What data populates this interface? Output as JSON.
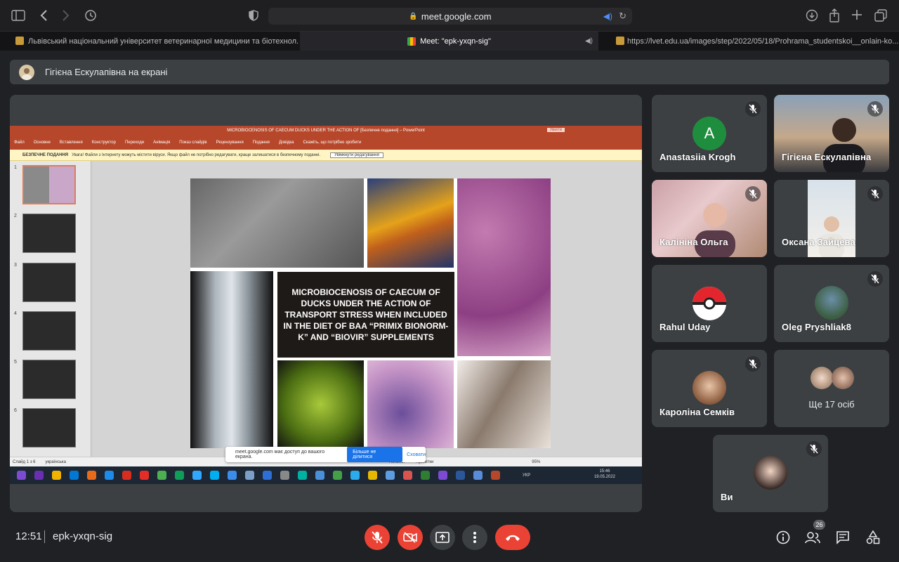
{
  "browser": {
    "url": "meet.google.com",
    "tabs": [
      {
        "label": "Львівський національний університет ветеринарної медицини та біотехнол..."
      },
      {
        "label": "Meet: \"epk-yxqn-sig\""
      },
      {
        "label": "https://lvet.edu.ua/images/step/2022/05/18/Prohrama_studentskoi__onlain-ko..."
      }
    ]
  },
  "banner": {
    "text": "Гігієна Ескулапівна на екрані"
  },
  "powerpoint": {
    "title": "MICROBIOCENOSIS OF CAECUM DUCKS UNDER THE ACTION OF [Безпечне подання] – PowerPoint",
    "login": "Увійти",
    "menu": [
      "Файл",
      "Основне",
      "Вставлення",
      "Конструктор",
      "Переходи",
      "Анімація",
      "Показ слайдів",
      "Рецензування",
      "Подання",
      "Довідка",
      "Скажіть, що потрібно зробити"
    ],
    "warning_label": "БЕЗПЕЧНЕ ПОДАННЯ",
    "warning_text": "Увага! Файли з Інтернету можуть містити віруси. Якщо файл не потрібно редагувати, краще залишатися в безпечному поданні.",
    "warning_button": "Увімкнути редагування",
    "thumb_numbers": [
      "1",
      "2",
      "3",
      "4",
      "5",
      "6"
    ],
    "slide_title": "MICROBIOCENOSIS OF CAECUM OF DUCKS UNDER THE ACTION OF TRANSPORT STRESS WHEN INCLUDED IN THE DIET OF BAA “PRIMIX BIONORM-K” AND “BIOVIR” SUPPLEMENTS",
    "status_left": "Слайд 1 з 6",
    "status_lang": "українська",
    "status_notes": "Нотатки",
    "status_comments": "Примітки",
    "zoom": "95%"
  },
  "share_note": {
    "text": "meet.google.com має доступ до вашого екрана.",
    "stop": "Більше не ділитися",
    "hide": "Сховати"
  },
  "taskbar": {
    "time": "15:46",
    "date": "19.05.2022",
    "lang": "УКР"
  },
  "participants": [
    {
      "name": "Anastasiia Krogh",
      "initial": "A",
      "color": "#1e8e3e"
    },
    {
      "name": "Гігієна Ескулапівна"
    },
    {
      "name": "Калініна Ольга"
    },
    {
      "name": "Оксана Зайцева"
    },
    {
      "name": "Rahul Uday"
    },
    {
      "name": "Oleg Pryshliak8"
    },
    {
      "name": "Кароліна Семків"
    },
    {
      "name": "Ще 17 осіб"
    },
    {
      "name": "Ви"
    }
  ],
  "bottom": {
    "clock": "12:51",
    "meeting_code": "epk-yxqn-sig",
    "people_count": "26"
  }
}
